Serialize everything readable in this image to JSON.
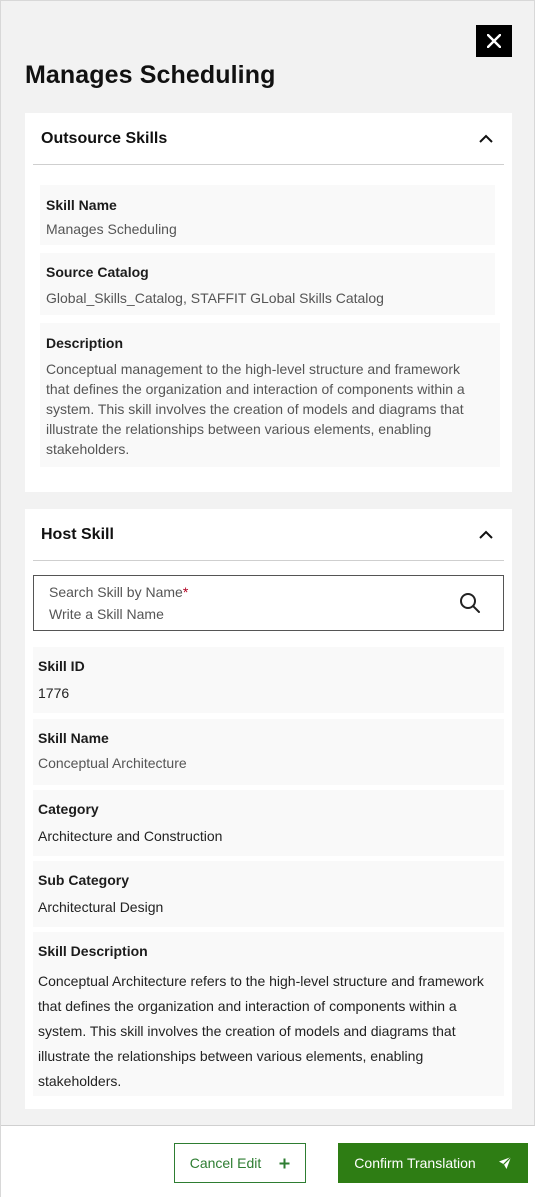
{
  "dialog": {
    "title": "Manages Scheduling",
    "close_icon": "close-icon"
  },
  "outsource": {
    "header": "Outsource Skills",
    "fields": {
      "skill_name": {
        "label": "Skill Name",
        "value": "Manages Scheduling"
      },
      "source_catalog": {
        "label": "Source Catalog",
        "value": "Global_Skills_Catalog, STAFFIT GLobal Skills Catalog"
      },
      "description": {
        "label": "Description",
        "lines": [
          "Conceptual management to the high-level structure and framework",
          "that defines the organization and interaction of components within a",
          "system. This skill involves the creation of models and diagrams that",
          "illustrate the relationships between various elements, enabling",
          "stakeholders."
        ]
      }
    }
  },
  "host": {
    "header": "Host Skill",
    "search": {
      "label": "Search Skill by Name",
      "required_mark": "*",
      "placeholder": "Write a Skill Name",
      "value": ""
    },
    "fields": {
      "skill_id": {
        "label": "Skill ID",
        "value": "1776"
      },
      "skill_name": {
        "label": "Skill Name",
        "value": "Conceptual Architecture"
      },
      "category": {
        "label": "Category",
        "value": "Architecture and Construction"
      },
      "sub_category": {
        "label": "Sub Category",
        "value": "Architectural Design"
      },
      "skill_description": {
        "label": "Skill Description",
        "lines": [
          "Conceptual Architecture refers to the high-level structure and framework",
          "that defines the organization and interaction of components within a",
          "system. This skill involves the creation of models and diagrams that",
          "illustrate the relationships between various elements, enabling",
          "stakeholders."
        ]
      }
    }
  },
  "footer": {
    "cancel_label": "Cancel Edit",
    "confirm_label": "Confirm Translation"
  },
  "colors": {
    "primary_green": "#2e7d14",
    "outline_green": "#2e7d32",
    "required_red": "#b00020"
  }
}
